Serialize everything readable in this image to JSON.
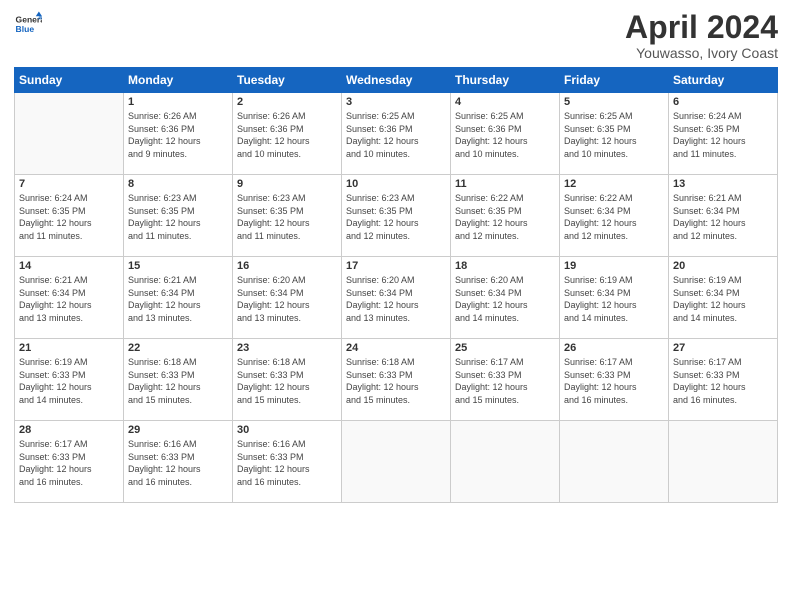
{
  "logo": {
    "line1": "General",
    "line2": "Blue"
  },
  "title": "April 2024",
  "subtitle": "Youwasso, Ivory Coast",
  "header": {
    "days": [
      "Sunday",
      "Monday",
      "Tuesday",
      "Wednesday",
      "Thursday",
      "Friday",
      "Saturday"
    ]
  },
  "weeks": [
    [
      {
        "day": "",
        "info": ""
      },
      {
        "day": "1",
        "info": "Sunrise: 6:26 AM\nSunset: 6:36 PM\nDaylight: 12 hours\nand 9 minutes."
      },
      {
        "day": "2",
        "info": "Sunrise: 6:26 AM\nSunset: 6:36 PM\nDaylight: 12 hours\nand 10 minutes."
      },
      {
        "day": "3",
        "info": "Sunrise: 6:25 AM\nSunset: 6:36 PM\nDaylight: 12 hours\nand 10 minutes."
      },
      {
        "day": "4",
        "info": "Sunrise: 6:25 AM\nSunset: 6:36 PM\nDaylight: 12 hours\nand 10 minutes."
      },
      {
        "day": "5",
        "info": "Sunrise: 6:25 AM\nSunset: 6:35 PM\nDaylight: 12 hours\nand 10 minutes."
      },
      {
        "day": "6",
        "info": "Sunrise: 6:24 AM\nSunset: 6:35 PM\nDaylight: 12 hours\nand 11 minutes."
      }
    ],
    [
      {
        "day": "7",
        "info": "Sunrise: 6:24 AM\nSunset: 6:35 PM\nDaylight: 12 hours\nand 11 minutes."
      },
      {
        "day": "8",
        "info": "Sunrise: 6:23 AM\nSunset: 6:35 PM\nDaylight: 12 hours\nand 11 minutes."
      },
      {
        "day": "9",
        "info": "Sunrise: 6:23 AM\nSunset: 6:35 PM\nDaylight: 12 hours\nand 11 minutes."
      },
      {
        "day": "10",
        "info": "Sunrise: 6:23 AM\nSunset: 6:35 PM\nDaylight: 12 hours\nand 12 minutes."
      },
      {
        "day": "11",
        "info": "Sunrise: 6:22 AM\nSunset: 6:35 PM\nDaylight: 12 hours\nand 12 minutes."
      },
      {
        "day": "12",
        "info": "Sunrise: 6:22 AM\nSunset: 6:34 PM\nDaylight: 12 hours\nand 12 minutes."
      },
      {
        "day": "13",
        "info": "Sunrise: 6:21 AM\nSunset: 6:34 PM\nDaylight: 12 hours\nand 12 minutes."
      }
    ],
    [
      {
        "day": "14",
        "info": "Sunrise: 6:21 AM\nSunset: 6:34 PM\nDaylight: 12 hours\nand 13 minutes."
      },
      {
        "day": "15",
        "info": "Sunrise: 6:21 AM\nSunset: 6:34 PM\nDaylight: 12 hours\nand 13 minutes."
      },
      {
        "day": "16",
        "info": "Sunrise: 6:20 AM\nSunset: 6:34 PM\nDaylight: 12 hours\nand 13 minutes."
      },
      {
        "day": "17",
        "info": "Sunrise: 6:20 AM\nSunset: 6:34 PM\nDaylight: 12 hours\nand 13 minutes."
      },
      {
        "day": "18",
        "info": "Sunrise: 6:20 AM\nSunset: 6:34 PM\nDaylight: 12 hours\nand 14 minutes."
      },
      {
        "day": "19",
        "info": "Sunrise: 6:19 AM\nSunset: 6:34 PM\nDaylight: 12 hours\nand 14 minutes."
      },
      {
        "day": "20",
        "info": "Sunrise: 6:19 AM\nSunset: 6:34 PM\nDaylight: 12 hours\nand 14 minutes."
      }
    ],
    [
      {
        "day": "21",
        "info": "Sunrise: 6:19 AM\nSunset: 6:33 PM\nDaylight: 12 hours\nand 14 minutes."
      },
      {
        "day": "22",
        "info": "Sunrise: 6:18 AM\nSunset: 6:33 PM\nDaylight: 12 hours\nand 15 minutes."
      },
      {
        "day": "23",
        "info": "Sunrise: 6:18 AM\nSunset: 6:33 PM\nDaylight: 12 hours\nand 15 minutes."
      },
      {
        "day": "24",
        "info": "Sunrise: 6:18 AM\nSunset: 6:33 PM\nDaylight: 12 hours\nand 15 minutes."
      },
      {
        "day": "25",
        "info": "Sunrise: 6:17 AM\nSunset: 6:33 PM\nDaylight: 12 hours\nand 15 minutes."
      },
      {
        "day": "26",
        "info": "Sunrise: 6:17 AM\nSunset: 6:33 PM\nDaylight: 12 hours\nand 16 minutes."
      },
      {
        "day": "27",
        "info": "Sunrise: 6:17 AM\nSunset: 6:33 PM\nDaylight: 12 hours\nand 16 minutes."
      }
    ],
    [
      {
        "day": "28",
        "info": "Sunrise: 6:17 AM\nSunset: 6:33 PM\nDaylight: 12 hours\nand 16 minutes."
      },
      {
        "day": "29",
        "info": "Sunrise: 6:16 AM\nSunset: 6:33 PM\nDaylight: 12 hours\nand 16 minutes."
      },
      {
        "day": "30",
        "info": "Sunrise: 6:16 AM\nSunset: 6:33 PM\nDaylight: 12 hours\nand 16 minutes."
      },
      {
        "day": "",
        "info": ""
      },
      {
        "day": "",
        "info": ""
      },
      {
        "day": "",
        "info": ""
      },
      {
        "day": "",
        "info": ""
      }
    ]
  ]
}
